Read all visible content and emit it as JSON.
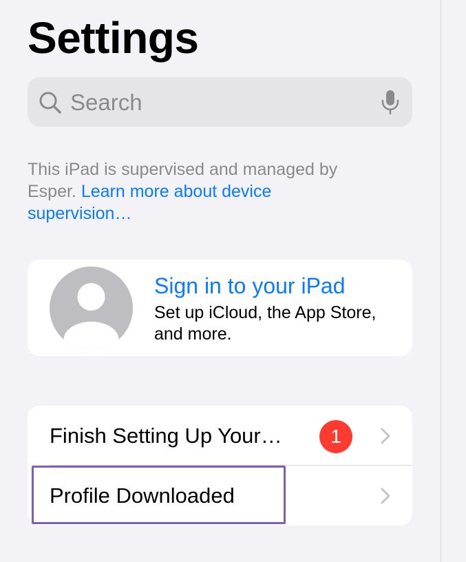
{
  "header": {
    "title": "Settings"
  },
  "search": {
    "placeholder": "Search"
  },
  "supervision": {
    "text": "This iPad is supervised and managed by Esper.",
    "link": "Learn more about device supervision…"
  },
  "account": {
    "title": "Sign in to your iPad",
    "subtitle": "Set up iCloud, the App Store, and more."
  },
  "list": {
    "items": [
      {
        "label": "Finish Setting Up Your…",
        "badge": "1"
      },
      {
        "label": "Profile Downloaded"
      }
    ]
  },
  "colors": {
    "accent": "#0a7aff",
    "badge": "#ff3b30",
    "highlight": "#7b5fb8",
    "background": "#f2f2f7"
  }
}
